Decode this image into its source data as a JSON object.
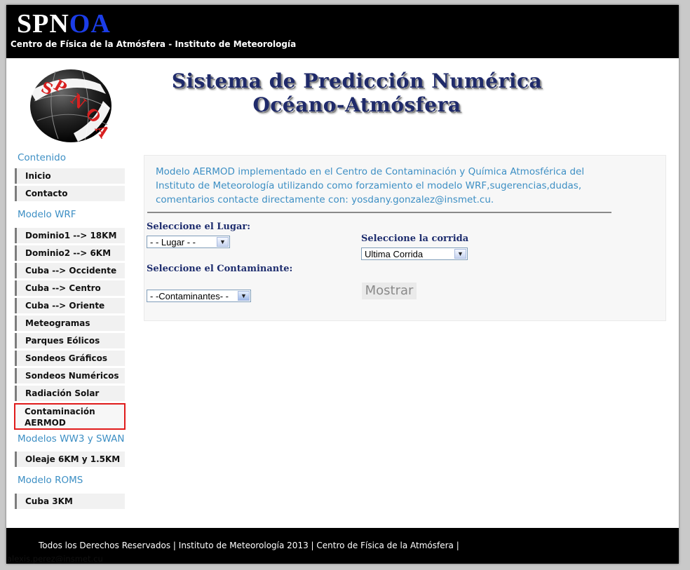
{
  "header": {
    "brand_part1": "SPN",
    "brand_part2": "OA",
    "subtitle": "Centro de Física de la Atmósfera - Instituto de Meteorología"
  },
  "logo": {
    "text": "SPNOA"
  },
  "main_title": {
    "line1": "Sistema de Predicción Numérica",
    "line2": "Océano-Atmósfera"
  },
  "sidebar": {
    "sections": [
      {
        "title": "Contenido",
        "items": [
          "Inicio",
          "Contacto"
        ]
      },
      {
        "title": "Modelo WRF",
        "items": [
          "Dominio1 --> 18KM",
          "Dominio2 --> 6KM",
          "Cuba --> Occidente",
          "Cuba --> Centro",
          "Cuba --> Oriente",
          "Meteogramas",
          "Parques Eólicos",
          "Sondeos Gráficos",
          "Sondeos Numéricos",
          "Radiación Solar",
          "Contaminación AERMOD"
        ]
      },
      {
        "title": "Modelos WW3 y SWAN",
        "items": [
          "Oleaje 6KM y 1.5KM"
        ]
      },
      {
        "title": "Modelo ROMS",
        "items": [
          "Cuba 3KM"
        ]
      }
    ],
    "active_item": "Contaminación AERMOD"
  },
  "content": {
    "info_text": "Modelo AERMOD implementado en el Centro de Contaminación y Química Atmosférica del Instituto de Meteorología utilizando como forzamiento el modelo WRF,sugerencias,dudas, comentarios contacte directamente con: yosdany.gonzalez@insmet.cu.",
    "lugar_label": "Seleccione el Lugar:",
    "lugar_value": "- - Lugar - -",
    "corrida_label": "Seleccione la corrida",
    "corrida_value": "Ultima Corrida",
    "contaminante_label": "Seleccione el Contaminante:",
    "contaminante_value": "- -Contaminantes- -",
    "mostrar_button": "Mostrar"
  },
  "footer": {
    "line1": "Todos los Derechos Reservados | Instituto de Meteorología 2013 | Centro de Física de la Atmósfera |",
    "line2": "alexis.perez@insmet.cu"
  },
  "colors": {
    "accent_blue": "#3d8fc4",
    "brand_blue": "#1b3de8",
    "label_navy": "#1e2d6e",
    "active_border": "#e01b1b"
  }
}
